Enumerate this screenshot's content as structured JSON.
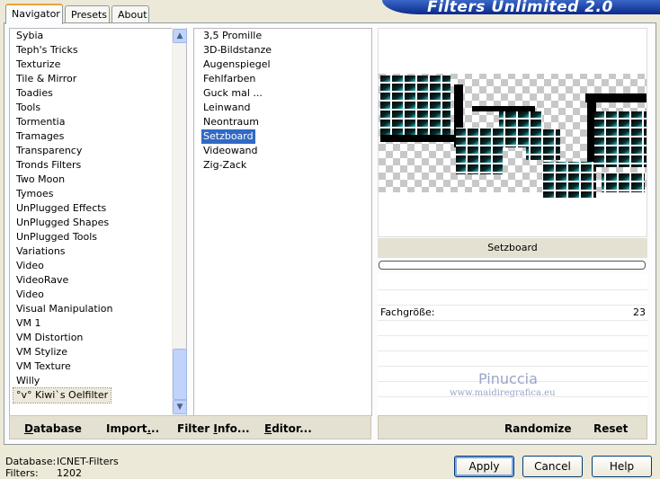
{
  "tabs": [
    "Navigator",
    "Presets",
    "About"
  ],
  "banner_title": "Filters Unlimited 2.0",
  "categories": [
    "Sybia",
    "Teph's Tricks",
    "Texturize",
    "Tile & Mirror",
    "Toadies",
    "Tools",
    "Tormentia",
    "Tramages",
    "Transparency",
    "Tronds Filters",
    "Two Moon",
    "Tymoes",
    "UnPlugged Effects",
    "UnPlugged Shapes",
    "UnPlugged Tools",
    "Variations",
    "Video",
    "VideoRave",
    "Video",
    "Visual Manipulation",
    "VM 1",
    "VM Distortion",
    "VM Stylize",
    "VM Texture",
    "Willy",
    "°v° Kiwi`s Oelfilter"
  ],
  "selected_category": "°v° Kiwi`s Oelfilter",
  "filters": [
    "3,5 Promille",
    "3D-Bildstanze",
    "Augenspiegel",
    "Fehlfarben",
    "Guck mal ...",
    "Leinwand",
    "Neontraum",
    "Setzboard",
    "Videowand",
    "Zig-Zack"
  ],
  "selected_filter": "Setzboard",
  "preview_filter_name": "Setzboard",
  "param": {
    "name": "Fachgröße:",
    "value": "23"
  },
  "watermark": {
    "line1": "Pinuccia",
    "line2": "www.maidiregrafica.eu"
  },
  "toolbar": {
    "database": {
      "underline": "D",
      "rest": "atabase"
    },
    "import": {
      "pre": "Import",
      "underline": ".",
      "rest": ".."
    },
    "filter_info": {
      "pre": "Filter ",
      "underline": "I",
      "rest": "nfo..."
    },
    "editor": {
      "underline": "E",
      "rest": "ditor..."
    },
    "randomize": "Randomize",
    "reset": "Reset"
  },
  "status": {
    "database_label": "Database:",
    "database_value": "ICNET-Filters",
    "filters_label": "Filters:",
    "filters_value": "1202"
  },
  "buttons": {
    "apply": "Apply",
    "cancel": "Cancel",
    "help": "Help"
  },
  "colors": {
    "accent": "#316ac5",
    "banner": "#0a2a8a",
    "preview_cyan": "#27c3c8"
  }
}
